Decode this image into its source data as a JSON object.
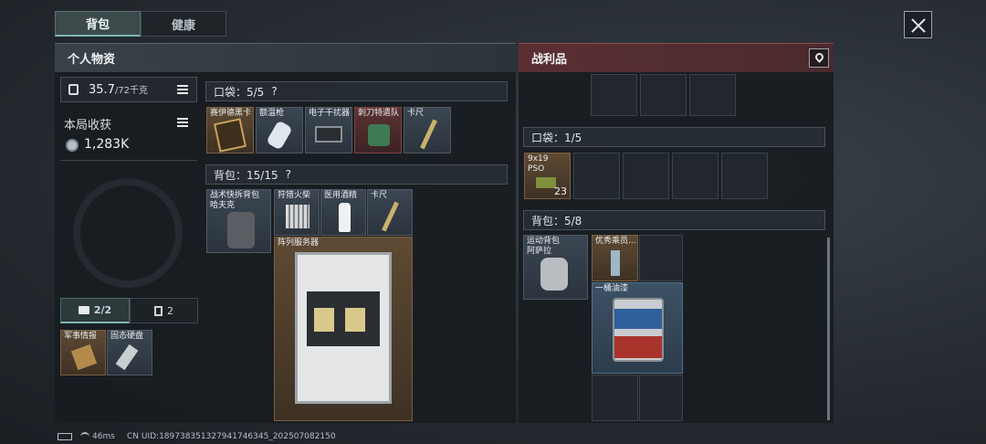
{
  "tabs": [
    "背包",
    "健康"
  ],
  "personal": {
    "title": "个人物资",
    "weight": "35.7",
    "weight_cap": "/72千克",
    "income_label": "本局收获",
    "income_value": "1,283K",
    "tab_a": "2/2",
    "tab_b": "2"
  },
  "pocket": {
    "label": "口袋：5/5",
    "help": "?",
    "items": [
      "赛伊德黑卡",
      "额温枪",
      "电子干扰器",
      "刺刀特遣队",
      "卡尺"
    ]
  },
  "backpack": {
    "label": "背包：15/15",
    "help": "?",
    "items": [
      "战术快拆背包\n哈夫克",
      "狩猎火柴",
      "医用酒精",
      "卡尺",
      "阵列服务器"
    ]
  },
  "secure": [
    "军事情报",
    "固态硬盘"
  ],
  "loot": {
    "title": "战利品",
    "pocket_label": "口袋：1/5",
    "pocket_item": "9x19\nPSO",
    "pocket_count": "23",
    "backpack_label": "背包：5/8",
    "backpack_items": [
      "运动背包\n阿萨拉",
      "优秀乘员...",
      "一桶油漆"
    ]
  },
  "status": {
    "signal": "46ms",
    "uid": "CN UID:189738351327941746345_202507082150"
  },
  "colors": {
    "accent": "#6fa8a0",
    "loot_header": "#5a2f33"
  }
}
